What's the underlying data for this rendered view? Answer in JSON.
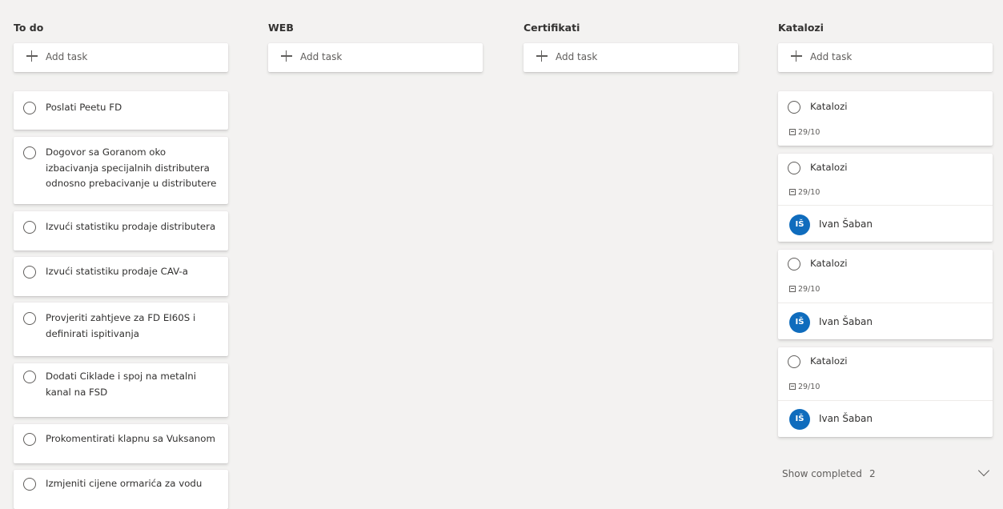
{
  "add_task_label": "Add task",
  "buckets": [
    {
      "title": "To do",
      "tasks": [
        {
          "title": "Poslati Peetu FD"
        },
        {
          "title": "Dogovor sa Goranom oko izbacivanja specijalnih distributera odnosno prebacivanje u distributere"
        },
        {
          "title": "Izvući statistiku prodaje distributera"
        },
        {
          "title": "Izvući statistiku prodaje CAV-a"
        },
        {
          "title": "Provjeriti zahtjeve za FD EI60S i definirati ispitivanja"
        },
        {
          "title": "Dodati Ciklade i spoj na metalni kanal na FSD"
        },
        {
          "title": "Prokomentirati klapnu sa Vuksanom"
        },
        {
          "title": "Izmjeniti cijene ormarića za vodu"
        }
      ]
    },
    {
      "title": "WEB",
      "tasks": []
    },
    {
      "title": "Certifikati",
      "tasks": []
    },
    {
      "title": "Katalozi",
      "tasks": [
        {
          "title": "Katalozi",
          "due": "29/10"
        },
        {
          "title": "Katalozi",
          "due": "29/10",
          "assignee": {
            "initials": "IŠ",
            "name": "Ivan Šaban"
          }
        },
        {
          "title": "Katalozi",
          "due": "29/10",
          "assignee": {
            "initials": "IŠ",
            "name": "Ivan Šaban"
          }
        },
        {
          "title": "Katalozi",
          "due": "29/10",
          "assignee": {
            "initials": "IŠ",
            "name": "Ivan Šaban"
          }
        }
      ]
    }
  ],
  "show_completed": {
    "label": "Show completed",
    "count": "2"
  },
  "colors": {
    "background": "#f3f2f1",
    "avatar": "#0f6cbd",
    "card": "#ffffff"
  },
  "icons": [
    "plus-icon",
    "circle-checkbox-icon",
    "calendar-icon",
    "chevron-down-icon"
  ]
}
